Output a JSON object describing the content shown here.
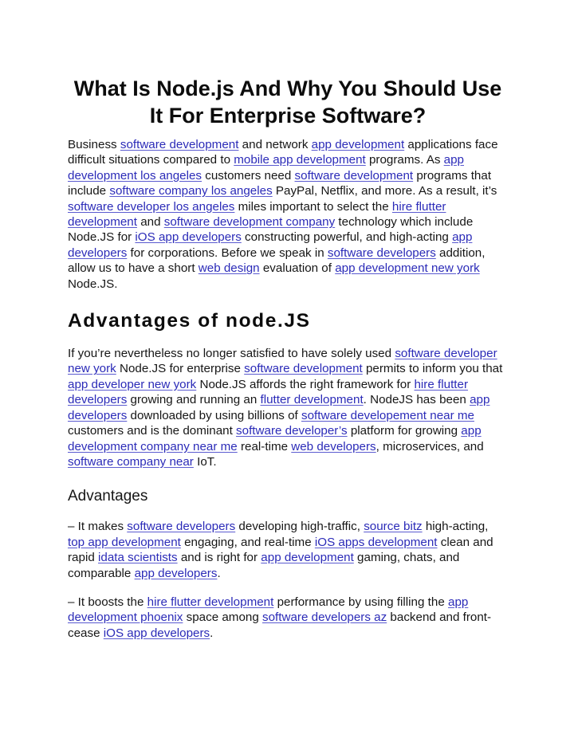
{
  "colors": {
    "link": "#2b2bb8",
    "text": "#161616",
    "background": "#ffffff"
  },
  "title": "What Is Node.js And Why You Should Use It For Enterprise Software?",
  "intro": [
    {
      "t": "Business "
    },
    {
      "link": "software development"
    },
    {
      "t": " and network "
    },
    {
      "link": "app development"
    },
    {
      "t": " applications face difficult situations compared to "
    },
    {
      "link": "mobile app development"
    },
    {
      "t": " programs. As "
    },
    {
      "link": "app development los angeles"
    },
    {
      "t": " customers need "
    },
    {
      "link": "software development"
    },
    {
      "t": " programs that include "
    },
    {
      "link": "software company los angeles"
    },
    {
      "t": " PayPal, Netflix, and more. As a result, it’s "
    },
    {
      "link": "software developer los angeles"
    },
    {
      "t": " miles important to select the "
    },
    {
      "link": "hire flutter development"
    },
    {
      "t": " and "
    },
    {
      "link": "software development company"
    },
    {
      "t": " technology which include Node.JS for "
    },
    {
      "link": "iOS app developers"
    },
    {
      "t": " constructing powerful, and high-acting "
    },
    {
      "link": "app developers"
    },
    {
      "t": " for corporations. Before we speak in "
    },
    {
      "link": "software developers"
    },
    {
      "t": " addition, allow us to have a short "
    },
    {
      "link": "web design"
    },
    {
      "t": " evaluation of "
    },
    {
      "link": "app development new york"
    },
    {
      "t": " Node.JS."
    }
  ],
  "section_heading": "Advantages of node.JS",
  "section_paragraph": [
    {
      "t": "If you’re nevertheless no longer satisfied to have solely used "
    },
    {
      "link": "software developer new york"
    },
    {
      "t": " Node.JS for enterprise "
    },
    {
      "link": "software development"
    },
    {
      "t": " permits to inform you that "
    },
    {
      "link": "app developer new york"
    },
    {
      "t": " Node.JS affords the right framework for "
    },
    {
      "link": "hire flutter developers"
    },
    {
      "t": " growing and running an "
    },
    {
      "link": "flutter development"
    },
    {
      "t": ". NodeJS has been "
    },
    {
      "link": "app developers"
    },
    {
      "t": " downloaded by using billions of "
    },
    {
      "link": "software developement near me"
    },
    {
      "t": " customers and is the dominant "
    },
    {
      "link": "software developer’s"
    },
    {
      "t": " platform for growing "
    },
    {
      "link": "app development company near me"
    },
    {
      "t": " real-time "
    },
    {
      "link": "web developers"
    },
    {
      "t": ", microservices, and "
    },
    {
      "link": "software company near"
    },
    {
      "t": " IoT."
    }
  ],
  "subheading": "Advantages",
  "advantage_1": [
    {
      "t": "– It makes "
    },
    {
      "link": "software developers"
    },
    {
      "t": " developing high-traffic, "
    },
    {
      "link": "source bitz"
    },
    {
      "t": " high-acting, "
    },
    {
      "link": "top app development"
    },
    {
      "t": " engaging, and real-time "
    },
    {
      "link": "iOS apps development"
    },
    {
      "t": " clean and rapid "
    },
    {
      "link": "idata scientists"
    },
    {
      "t": " and is right for "
    },
    {
      "link": "app development"
    },
    {
      "t": " gaming, chats, and comparable "
    },
    {
      "link": "app developers"
    },
    {
      "t": "."
    }
  ],
  "advantage_2": [
    {
      "t": "– It boosts the "
    },
    {
      "link": "hire flutter development"
    },
    {
      "t": " performance by using filling the "
    },
    {
      "link": "app development phoenix"
    },
    {
      "t": " space among "
    },
    {
      "link": "software developers az"
    },
    {
      "t": " backend and front-cease "
    },
    {
      "link": "iOS app developers"
    },
    {
      "t": "."
    }
  ]
}
